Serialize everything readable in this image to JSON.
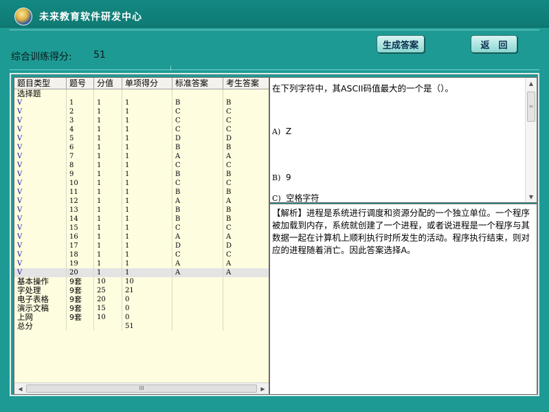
{
  "app": {
    "title": "未来教育软件研发中心",
    "logo_icon": "logo-badge-icon"
  },
  "score": {
    "label": "综合训练得分:",
    "value": "51"
  },
  "buttons": {
    "generate": "生成答案",
    "back": "返　回"
  },
  "table": {
    "headers": [
      "题目类型",
      "题号",
      "分值",
      "单项得分",
      "标准答案",
      "考生答案"
    ],
    "section_label": "选择题",
    "rows": [
      [
        "V",
        "1",
        "1",
        "1",
        "B",
        "B"
      ],
      [
        "V",
        "2",
        "1",
        "1",
        "C",
        "C"
      ],
      [
        "V",
        "3",
        "1",
        "1",
        "C",
        "C"
      ],
      [
        "V",
        "4",
        "1",
        "1",
        "C",
        "C"
      ],
      [
        "V",
        "5",
        "1",
        "1",
        "D",
        "D"
      ],
      [
        "V",
        "6",
        "1",
        "1",
        "B",
        "B"
      ],
      [
        "V",
        "7",
        "1",
        "1",
        "A",
        "A"
      ],
      [
        "V",
        "8",
        "1",
        "1",
        "C",
        "C"
      ],
      [
        "V",
        "9",
        "1",
        "1",
        "B",
        "B"
      ],
      [
        "V",
        "10",
        "1",
        "1",
        "C",
        "C"
      ],
      [
        "V",
        "11",
        "1",
        "1",
        "B",
        "B"
      ],
      [
        "V",
        "12",
        "1",
        "1",
        "A",
        "A"
      ],
      [
        "V",
        "13",
        "1",
        "1",
        "B",
        "B"
      ],
      [
        "V",
        "14",
        "1",
        "1",
        "B",
        "B"
      ],
      [
        "V",
        "15",
        "1",
        "1",
        "C",
        "C"
      ],
      [
        "V",
        "16",
        "1",
        "1",
        "A",
        "A"
      ],
      [
        "V",
        "17",
        "1",
        "1",
        "D",
        "D"
      ],
      [
        "V",
        "18",
        "1",
        "1",
        "C",
        "C"
      ],
      [
        "V",
        "19",
        "1",
        "1",
        "A",
        "A"
      ],
      [
        "V",
        "20",
        "1",
        "1",
        "A",
        "A"
      ]
    ],
    "summary": [
      [
        "基本操作",
        "9套",
        "10",
        "10"
      ],
      [
        "字处理",
        "9套",
        "25",
        "21"
      ],
      [
        "电子表格",
        "9套",
        "20",
        "0"
      ],
      [
        "演示文稿",
        "9套",
        "15",
        "0"
      ],
      [
        "上网",
        "9套",
        "10",
        "0"
      ]
    ],
    "total": {
      "label": "总分",
      "value": "51"
    },
    "hscroll_grip": "III"
  },
  "question": {
    "text": "在下列字符中，其ASCII码值最大的一个是（）。",
    "options": [
      {
        "label": "A)",
        "text": "Z"
      },
      {
        "label": "B)",
        "text": "9"
      },
      {
        "label": "C)",
        "text": "空格字符"
      }
    ],
    "vscroll_grip": "="
  },
  "analysis": {
    "text": "【解析】进程是系统进行调度和资源分配的一个独立单位。一个程序被加载到内存，系统就创建了一个进程，或者说进程是一个程序与其数据一起在计算机上顺利执行时所发生的活动。程序执行结束，则对应的进程随着消亡。因此答案选择A。"
  },
  "colors": {
    "background": "#1e9a94",
    "titlebar": "#138882",
    "table_bg": "#fffde0",
    "choice_type": "#1010a0"
  }
}
